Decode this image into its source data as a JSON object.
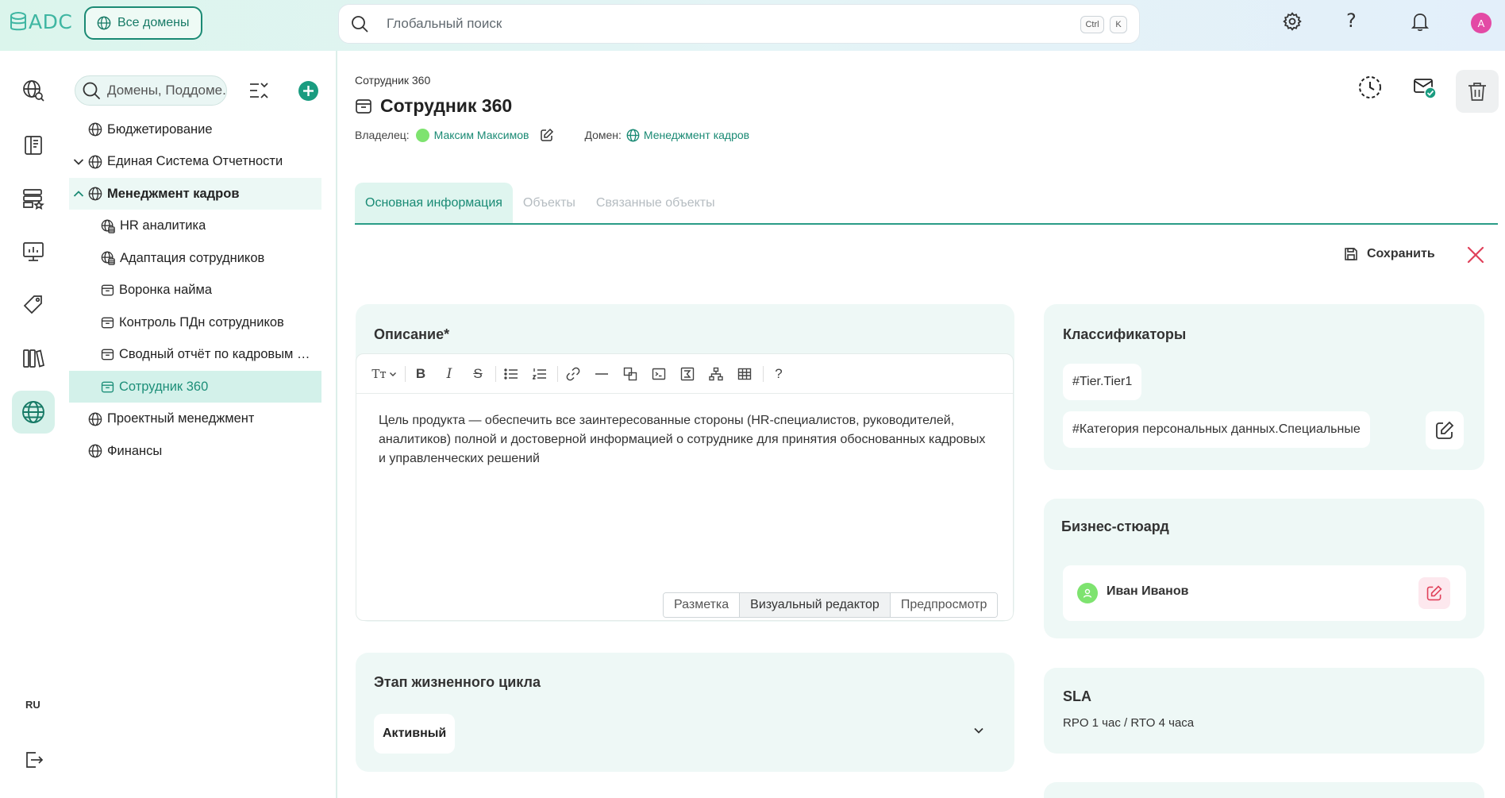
{
  "app": {
    "logo_text": "ADC",
    "brand_color": "#3fb6a2",
    "accent_color": "#1a8a74"
  },
  "topbar": {
    "domains_button": "Все домены",
    "search_placeholder": "Глобальный поиск",
    "shortcut_ctrl": "Ctrl",
    "shortcut_key": "K",
    "user_initial": "А",
    "icons": [
      "gear-icon",
      "help-icon",
      "bell-icon"
    ]
  },
  "rail": {
    "icons": [
      "globe-search-icon",
      "book-icon",
      "database-star-icon",
      "monitor-chart-icon",
      "tag-icon",
      "library-icon",
      "globe-icon"
    ],
    "active": "globe-icon",
    "language": "RU",
    "logout_icon": "logout-icon"
  },
  "tree": {
    "search_placeholder": "Домены, Поддоме...",
    "items": [
      {
        "label": "Бюджетирование",
        "icon": "globe-icon",
        "level": 0,
        "chevron": ""
      },
      {
        "label": "Единая Система Отчетности",
        "icon": "globe-icon",
        "level": 0,
        "chevron": "down"
      },
      {
        "label": "Менеджмент кадров",
        "icon": "globe-icon",
        "level": 0,
        "chevron": "up"
      },
      {
        "label": "HR аналитика",
        "icon": "globe-db-icon",
        "level": 1,
        "chevron": ""
      },
      {
        "label": "Адаптация сотрудников",
        "icon": "globe-db-icon",
        "level": 1,
        "chevron": ""
      },
      {
        "label": "Воронка найма",
        "icon": "product-icon",
        "level": 1,
        "chevron": ""
      },
      {
        "label": "Контроль ПДн сотрудников",
        "icon": "product-icon",
        "level": 1,
        "chevron": ""
      },
      {
        "label": "Сводный отчёт по кадровым …",
        "icon": "product-icon",
        "level": 1,
        "chevron": ""
      },
      {
        "label": "Сотрудник 360",
        "icon": "product-icon",
        "level": 1,
        "chevron": ""
      },
      {
        "label": "Проектный менеджмент",
        "icon": "globe-icon",
        "level": 0,
        "chevron": ""
      },
      {
        "label": "Финансы",
        "icon": "globe-icon",
        "level": 0,
        "chevron": ""
      }
    ]
  },
  "header": {
    "breadcrumb": "Сотрудник 360",
    "title": "Сотрудник 360",
    "owner_label": "Владелец:",
    "owner_name": "Максим Максимов",
    "domain_label": "Домен:",
    "domain_name": "Менеджмент кадров"
  },
  "tabs": [
    {
      "label": "Основная информация",
      "active": true
    },
    {
      "label": "Объекты",
      "active": false
    },
    {
      "label": "Связанные объекты",
      "active": false
    }
  ],
  "actions": {
    "save_label": "Сохранить"
  },
  "description": {
    "title": "Описание*",
    "text": "Цель продукта — обеспечить все заинтересованные стороны (HR-специалистов, руководителей, аналитиков) полной и достоверной информацией о сотруднике для принятия обоснованных кадровых и управленческих решений",
    "toolbar": {
      "heading": "Tт",
      "bold": "B",
      "italic": "I",
      "strike": "S",
      "help": "?"
    },
    "modes": [
      "Разметка",
      "Визуальный редактор",
      "Предпросмотр"
    ],
    "active_mode": "Визуальный редактор"
  },
  "lifecycle": {
    "title": "Этап жизненного цикла",
    "value": "Активный"
  },
  "classifiers": {
    "title": "Классификаторы",
    "tags": [
      "#Tier.Tier1",
      "#Категория персональных данных.Специальные"
    ]
  },
  "steward": {
    "title": "Бизнес-стюард",
    "name": "Иван Иванов"
  },
  "sla": {
    "title": "SLA",
    "value": "RPO 1 час / RTO 4 часа"
  }
}
